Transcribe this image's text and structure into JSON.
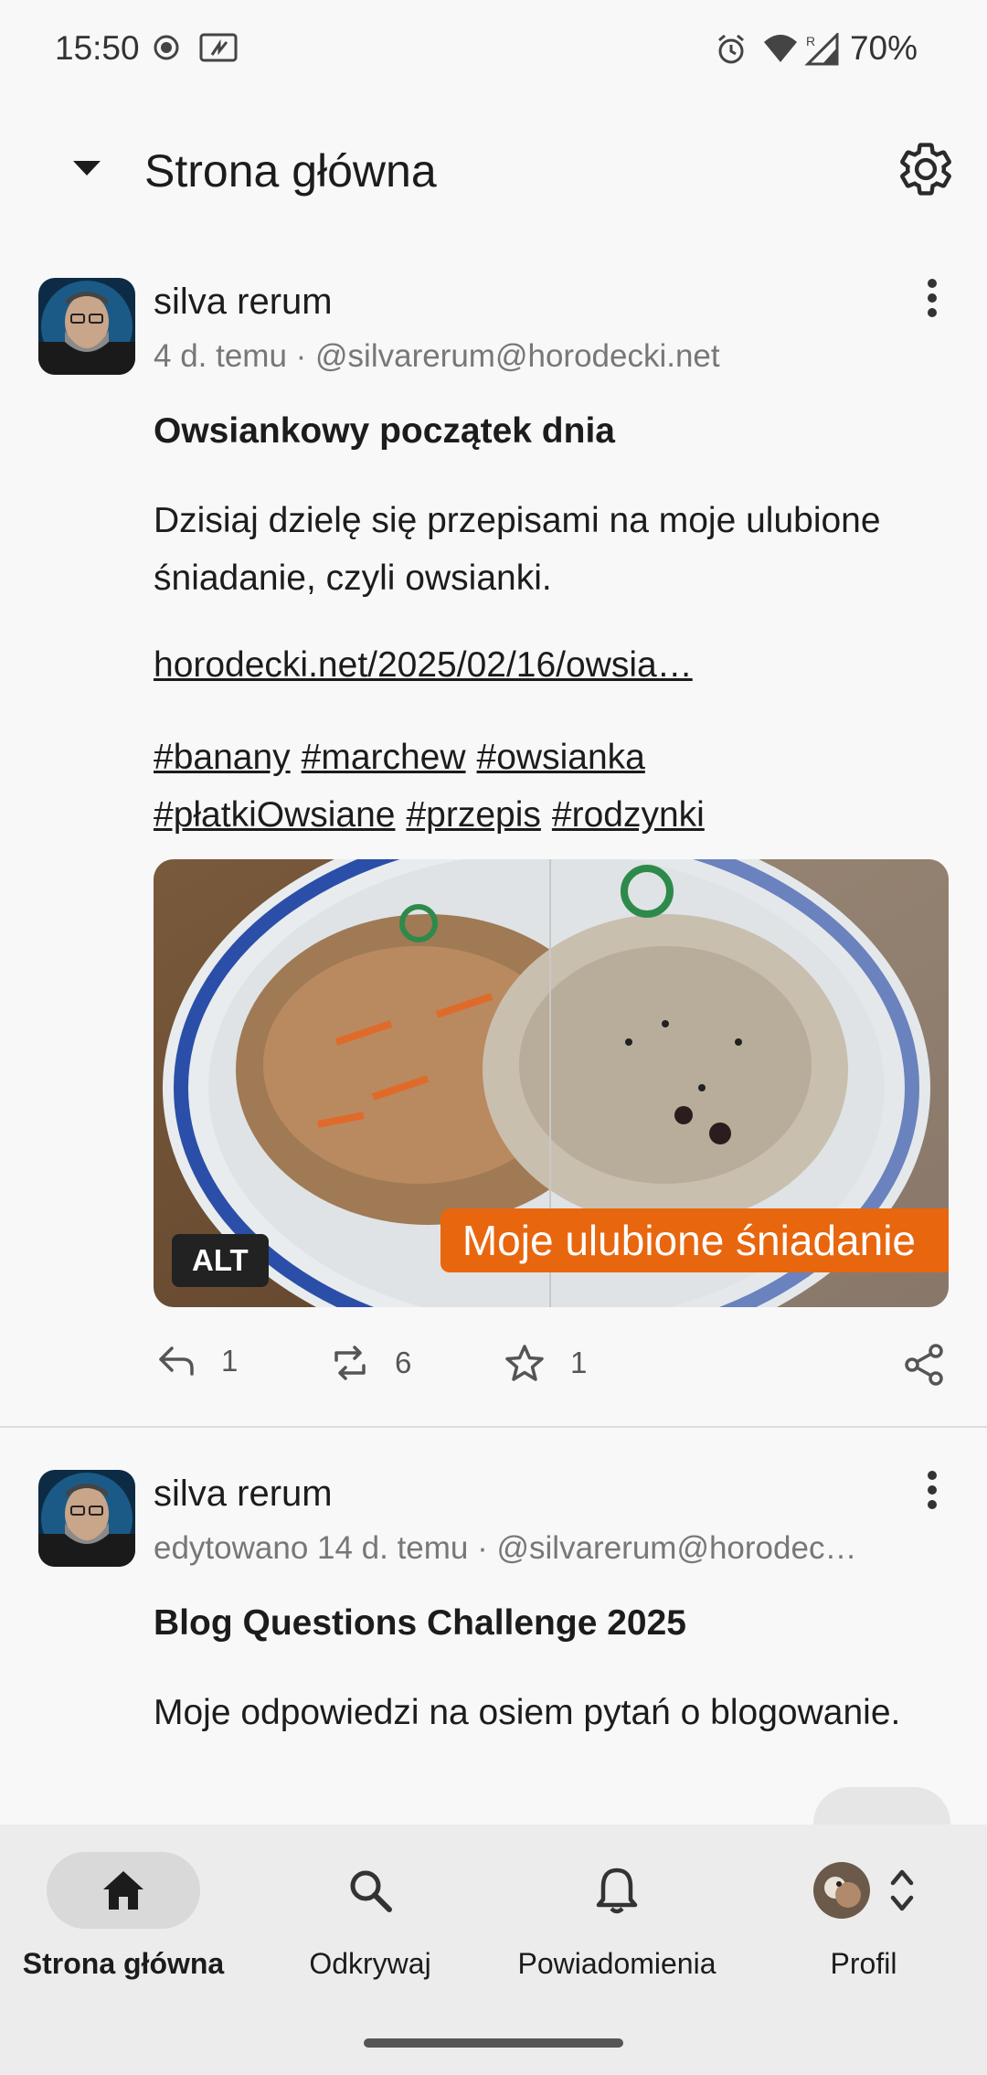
{
  "status_bar": {
    "time": "15:50",
    "battery": "70%",
    "icons": [
      "record-icon",
      "cast-icon",
      "alarm-icon",
      "wifi-icon",
      "signal-icon"
    ]
  },
  "header": {
    "title": "Strona główna",
    "icons": [
      "dropdown-arrow-icon",
      "gear-icon"
    ]
  },
  "posts": [
    {
      "author": "silva rerum",
      "meta": "4 d. temu · @silvarerum@horodecki.net",
      "title": "Owsiankowy początek dnia",
      "body": "Dzisiaj dzielę się przepisami na moje ulubione śniadanie, czyli owsianki.",
      "link": "horodecki.net/2025/02/16/owsia…",
      "tags": [
        "#banany",
        "#marchew",
        "#owsianka",
        "#płatkiOwsiane",
        "#przepis",
        "#rodzynki"
      ],
      "media": {
        "alt_label": "ALT",
        "caption": "Moje ulubione śniadanie"
      },
      "actions": {
        "replies": "1",
        "boosts": "6",
        "favourites": "1"
      }
    },
    {
      "author": "silva rerum",
      "meta": "edytowano 14 d. temu · @silvarerum@horodec…",
      "title": "Blog Questions Challenge 2025",
      "body": "Moje odpowiedzi na osiem pytań o blogowanie."
    }
  ],
  "bottom_nav": {
    "items": [
      {
        "label": "Strona główna",
        "icon": "home-icon",
        "active": true
      },
      {
        "label": "Odkrywaj",
        "icon": "search-icon",
        "active": false
      },
      {
        "label": "Powiadomienia",
        "icon": "bell-icon",
        "active": false
      },
      {
        "label": "Profil",
        "icon": "avatar",
        "active": false
      }
    ]
  },
  "colors": {
    "background": "#f8f8f8",
    "caption_accent": "#e8660e",
    "nav_background": "#ececec",
    "active_pill": "#d9d9d9"
  }
}
